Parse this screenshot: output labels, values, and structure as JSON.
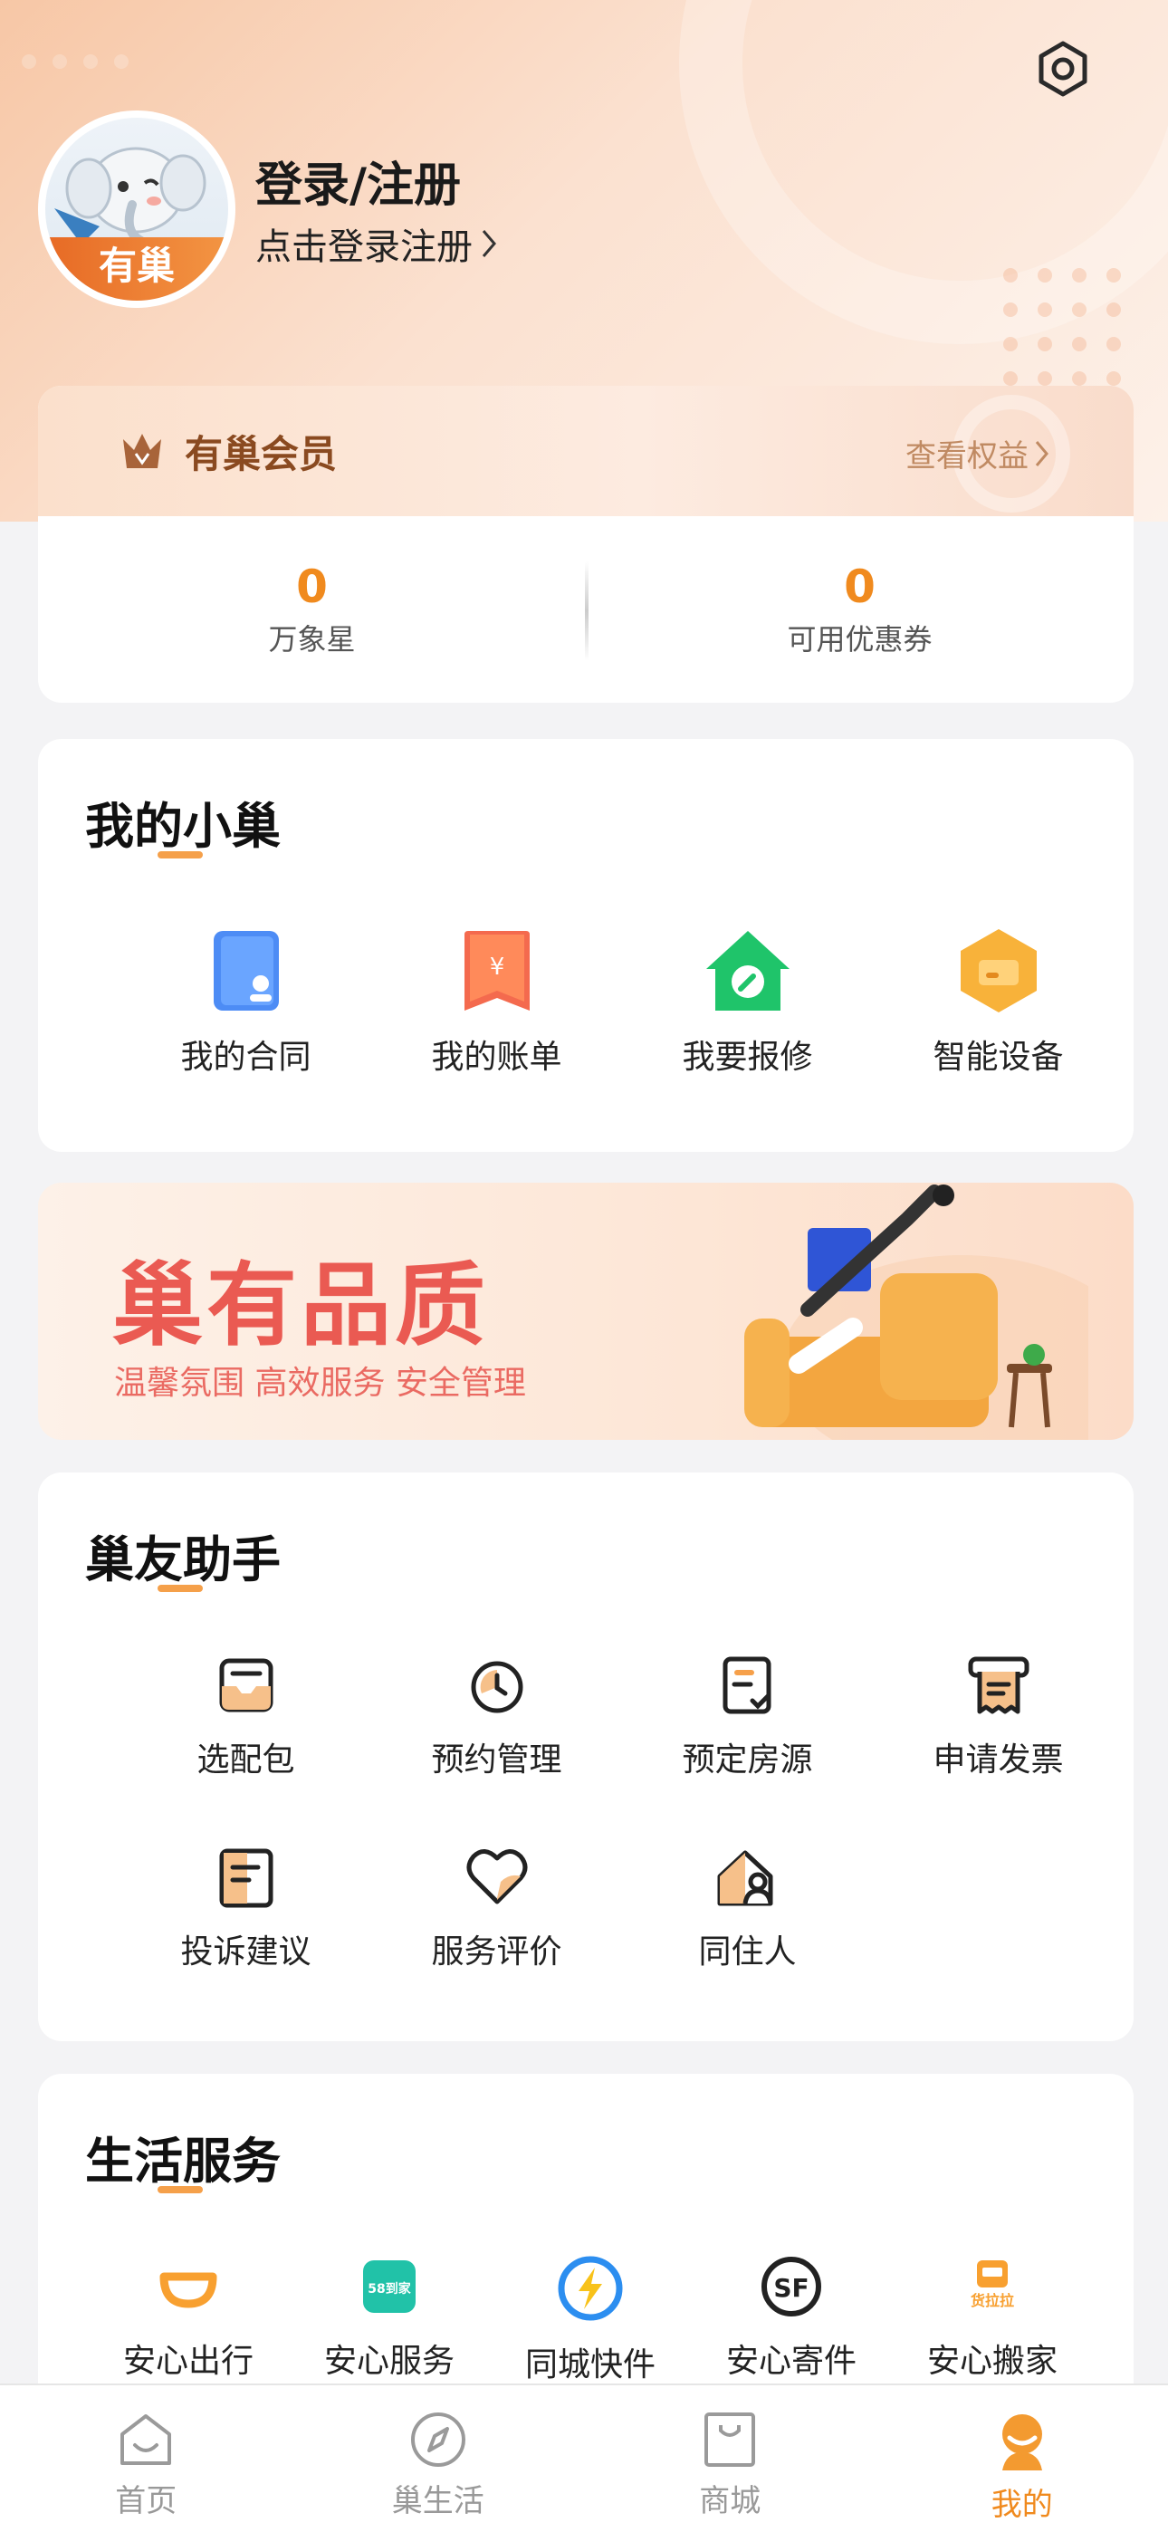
{
  "header": {
    "login_title": "登录/注册",
    "login_sub": "点击登录注册",
    "avatar_badge": "有巢"
  },
  "member": {
    "title": "有巢会员",
    "link": "查看权益",
    "stats": [
      {
        "value": "0",
        "label": "万象星"
      },
      {
        "value": "0",
        "label": "可用优惠券"
      }
    ]
  },
  "my_nest": {
    "title": "我的小巢",
    "items": [
      {
        "label": "我的合同",
        "icon": "contract-icon"
      },
      {
        "label": "我的账单",
        "icon": "bill-icon"
      },
      {
        "label": "我要报修",
        "icon": "repair-icon"
      },
      {
        "label": "智能设备",
        "icon": "smart-device-icon"
      }
    ]
  },
  "banner": {
    "title": "巢有品质",
    "subtitle": "温馨氛围  高效服务  安全管理"
  },
  "assistant": {
    "title": "巢友助手",
    "items": [
      {
        "label": "选配包",
        "icon": "package-icon"
      },
      {
        "label": "预约管理",
        "icon": "appointment-icon"
      },
      {
        "label": "预定房源",
        "icon": "booking-icon"
      },
      {
        "label": "申请发票",
        "icon": "invoice-icon"
      },
      {
        "label": "投诉建议",
        "icon": "complaint-icon"
      },
      {
        "label": "服务评价",
        "icon": "rating-icon"
      },
      {
        "label": "同住人",
        "icon": "roommate-icon"
      }
    ]
  },
  "life": {
    "title": "生活服务",
    "items": [
      {
        "label": "安心出行",
        "icon": "didi-icon",
        "logo_text": ""
      },
      {
        "label": "安心服务",
        "icon": "58-daojia-icon",
        "logo_text": "58到家"
      },
      {
        "label": "同城快件",
        "icon": "express-icon",
        "logo_text": ""
      },
      {
        "label": "安心寄件",
        "icon": "sf-express-icon",
        "logo_text": "SF"
      },
      {
        "label": "安心搬家",
        "icon": "lalamove-icon",
        "logo_text": "货拉拉"
      }
    ]
  },
  "tabs": [
    {
      "label": "首页",
      "icon": "home-icon"
    },
    {
      "label": "巢生活",
      "icon": "compass-icon"
    },
    {
      "label": "商城",
      "icon": "shopping-bag-icon"
    },
    {
      "label": "我的",
      "icon": "profile-icon",
      "active": true
    }
  ],
  "colors": {
    "accent": "#f08a1e",
    "banner_red": "#ea5a52",
    "member_brown": "#8a4a20"
  }
}
